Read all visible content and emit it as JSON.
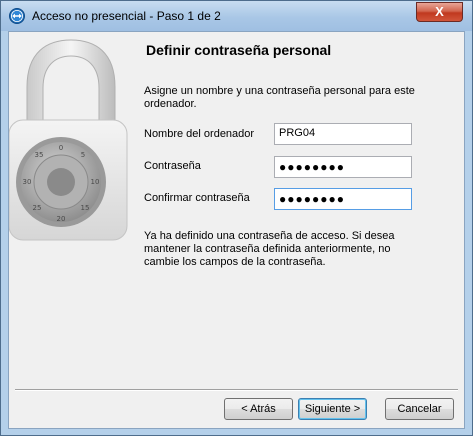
{
  "window": {
    "title": "Acceso no presencial - Paso 1 de 2",
    "close_glyph": "X"
  },
  "heading": "Definir contraseña personal",
  "intro": "Asigne un nombre y una contraseña personal para este ordenador.",
  "fields": {
    "computer_name": {
      "label": "Nombre del ordenador",
      "value": "PRG04"
    },
    "password": {
      "label": "Contraseña",
      "value": "●●●●●●●●"
    },
    "confirm_password": {
      "label": "Confirmar contraseña",
      "value": "●●●●●●●●"
    }
  },
  "info_text": "Ya ha definido una contraseña de acceso. Si desea mantener la contraseña definida anteriormente, no cambie los campos de la contraseña.",
  "buttons": {
    "back": "< Atrás",
    "next": "Siguiente >",
    "cancel": "Cancelar"
  },
  "icons": {
    "app": "teamviewer-icon",
    "art": "padlock-combination-icon"
  }
}
